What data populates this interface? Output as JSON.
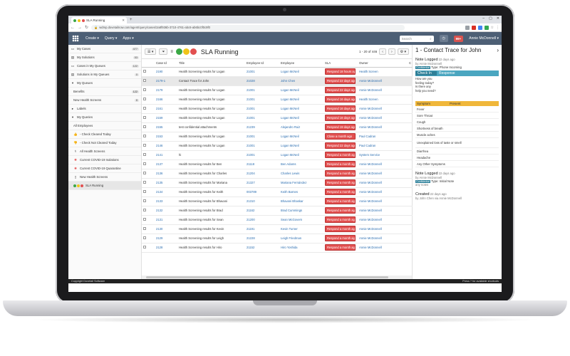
{
  "browser": {
    "tab_title": "SLA Running",
    "url": "wdmp.dovetailnow.com/agent/query/cases/2a8f936b-3710-4761-abc6-ab6bc0f0c9f0"
  },
  "header": {
    "menus": [
      "Create ▾",
      "Query ▾",
      "Apps ▾"
    ],
    "search_placeholder": "Search",
    "notifications": "99+",
    "user": "Annie McDonnell ▾"
  },
  "sidebar": {
    "items": [
      {
        "label": "My Cases",
        "count": "477"
      },
      {
        "label": "My Solutions",
        "count": "53"
      },
      {
        "label": "Cases in My Queues",
        "count": "122"
      },
      {
        "label": "Solutions in My Queues",
        "count": "0"
      }
    ],
    "queues_header": "My Queues",
    "queues": [
      {
        "label": "Benefits",
        "count": "122"
      },
      {
        "label": "New Health Screens",
        "count": "0"
      }
    ],
    "labels_header": "Labels",
    "my_queries_header": "My Queries",
    "queries": [
      "All Employees",
      "- Check Cleared Today",
      "- Check Not Cleared Today",
      "All Health Screens",
      "Current COVID-19 Isolations",
      "Current COVID-19 Quarantine",
      "New Health Screens",
      "SLA Running"
    ]
  },
  "view": {
    "title": "SLA Running",
    "pager": "1 - 20 of 446",
    "columns": [
      "",
      "Case Id",
      "Title",
      "Employee Id",
      "Employee",
      "SLA",
      "Owner",
      "C"
    ],
    "rows": [
      {
        "id": "2190",
        "title": "Health Screening results for Logan",
        "emp_id": "21001",
        "emp": "Logan McNeil",
        "sla": "Respond 18 hours ago",
        "owner": "Health Screen"
      },
      {
        "id": "2179-1",
        "title": "Contact Trace for John",
        "emp_id": "21028",
        "emp": "John Chen",
        "sla": "Respond 22 days ago",
        "owner": "Annie McDonnell"
      },
      {
        "id": "2179",
        "title": "Health Screening results for Logan",
        "emp_id": "21001",
        "emp": "Logan McNeil",
        "sla": "Respond 22 days ago",
        "owner": "Annie McDonnell"
      },
      {
        "id": "2166",
        "title": "Health Screening results for Logan",
        "emp_id": "21001",
        "emp": "Logan McNeil",
        "sla": "Respond 16 days ago",
        "owner": "Health Screen"
      },
      {
        "id": "2161",
        "title": "Health Screening results for Logan",
        "emp_id": "21001",
        "emp": "Logan McNeil",
        "sla": "Respond 16 days ago",
        "owner": "Annie McDonnell"
      },
      {
        "id": "2159",
        "title": "Health Screening results for Logan",
        "emp_id": "21001",
        "emp": "Logan McNeil",
        "sla": "Respond 16 days ago",
        "owner": "Annie McDonnell"
      },
      {
        "id": "2155",
        "title": "test confidential attachments",
        "emp_id": "21239",
        "emp": "Alejandro Ruiz",
        "sla": "Respond 19 days ago",
        "owner": "Annie McDonnell"
      },
      {
        "id": "2153",
        "title": "Health Screening results for Logan",
        "emp_id": "21001",
        "emp": "Logan McNeil",
        "sla": "Close a month ago",
        "owner": "Paul Cadran"
      },
      {
        "id": "2146",
        "title": "Health Screening results for Logan",
        "emp_id": "21001",
        "emp": "Logan McNeil",
        "sla": "Respond 22 days ago",
        "owner": "Paul Cadran"
      },
      {
        "id": "2141",
        "title": "hi",
        "emp_id": "21001",
        "emp": "Logan McNeil",
        "sla": "Respond a month ago",
        "owner": "System Service"
      },
      {
        "id": "2137",
        "title": "Health Screening results for Ben",
        "emp_id": "21118",
        "emp": "Ben Adams",
        "sla": "Respond a month ago",
        "owner": "Annie McDonnell"
      },
      {
        "id": "2136",
        "title": "Health Screening results for Charles",
        "emp_id": "21204",
        "emp": "Charles Lewis",
        "sla": "Respond a month ago",
        "owner": "Annie McDonnell"
      },
      {
        "id": "2135",
        "title": "Health Screening results for Mariana",
        "emp_id": "21327",
        "emp": "Mariana Fernández",
        "sla": "Respond a month ago",
        "owner": "Annie McDonnell"
      },
      {
        "id": "2134",
        "title": "Health Screening results for Keith",
        "emp_id": "003789",
        "emp": "Keith Barnes",
        "sla": "Respond a month ago",
        "owner": "Annie McDonnell"
      },
      {
        "id": "2133",
        "title": "Health Screening results for Bhavani",
        "emp_id": "21310",
        "emp": "Bhavani Bhaskar",
        "sla": "Respond a month ago",
        "owner": "Annie McDonnell"
      },
      {
        "id": "2132",
        "title": "Health Screening results for Brad",
        "emp_id": "21162",
        "emp": "Brad Cummings",
        "sla": "Respond a month ago",
        "owner": "Annie McDonnell"
      },
      {
        "id": "2131",
        "title": "Health Screening results for Sean",
        "emp_id": "21200",
        "emp": "Sean McGovern",
        "sla": "Respond a month ago",
        "owner": "Annie McDonnell"
      },
      {
        "id": "2130",
        "title": "Health Screening results for Kevin",
        "emp_id": "21191",
        "emp": "Kevin Turner",
        "sla": "Respond a month ago",
        "owner": "Annie McDonnell"
      },
      {
        "id": "2129",
        "title": "Health Screening results for Leigh",
        "emp_id": "21228",
        "emp": "Leigh Friedman",
        "sla": "Respond a month ago",
        "owner": "Annie McDonnell"
      },
      {
        "id": "2128",
        "title": "Health Screening results for Hiro",
        "emp_id": "21152",
        "emp": "Hiro Yoshida",
        "sla": "Respond a month ago",
        "owner": "Annie McDonnell"
      }
    ]
  },
  "detail": {
    "title": "1 - Contact Trace for John",
    "note1": {
      "heading": "Note Logged",
      "ago": "22 days ago",
      "by": "by Annie McDonnell",
      "tag": "Confidential",
      "type": "Type: Phone Incoming"
    },
    "checkin": {
      "col1": "Check In",
      "col2": "Response",
      "question": "How are you feeling today? Is there any help you need?"
    },
    "symptoms": {
      "col1": "Symptom",
      "col2": "Present",
      "rows": [
        "Fever",
        "Sore Throat",
        "Cough",
        "Shortness of breath",
        "Muscle aches",
        "Unexplained loss of taste or smell",
        "Diarrhea",
        "Headache",
        "Any Other Symptoms"
      ]
    },
    "note2": {
      "heading": "Note Logged",
      "ago": "22 days ago",
      "by": "by Annie McDonnell",
      "tag": "Confidential",
      "type": "Type: Initial Note",
      "extra": "any notes"
    },
    "created": {
      "heading": "Created",
      "ago": "22 days ago",
      "by": "by John Chen via Annie McDonnell"
    }
  },
  "statusbar": {
    "left": "Copyright Dovetail Software",
    "right": "Press ? for available shortcuts"
  },
  "colors": {
    "red": "#e25050",
    "yellow": "#f0c419",
    "green": "#3aa845",
    "header": "#4d5f75",
    "teal": "#4aa6c0",
    "orange": "#f0b73a"
  }
}
